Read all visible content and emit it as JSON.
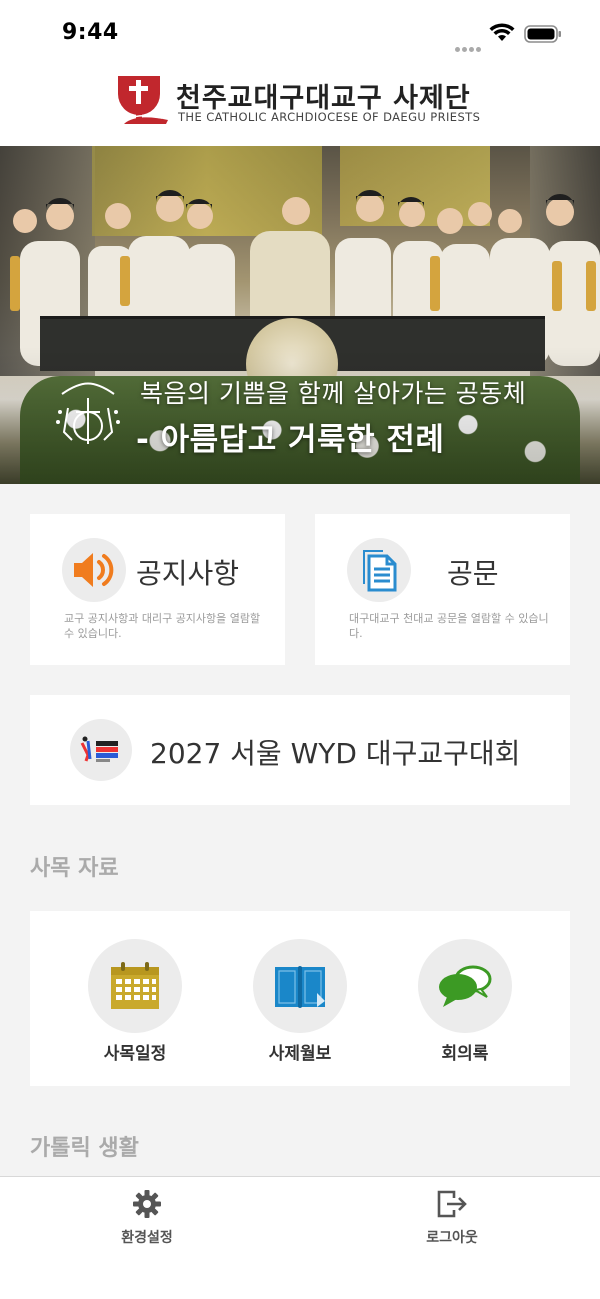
{
  "status_bar": {
    "time": "9:44"
  },
  "header": {
    "title": "천주교대구대교구 사제단",
    "subtitle": "THE CATHOLIC ARCHDIOCESE OF DAEGU PRIESTS"
  },
  "banner": {
    "line1": "복음의 기쁨을 함께 살아가는 공동체",
    "line2": "- 아름답고 거룩한 전례"
  },
  "cards": {
    "notice": {
      "title": "공지사항",
      "description": "교구 공지사항과 대리구 공지사항을 열람할 수 있습니다.",
      "icon": "speaker-icon",
      "accent": "#f07c1e"
    },
    "official": {
      "title": "공문",
      "description": "대구대교구 천대교 공문을 열람할 수 있습니다.",
      "icon": "documents-icon",
      "accent": "#2a8ccf"
    },
    "wyd": {
      "title": "2027 서울 WYD 대구교구대회",
      "icon": "wyd-logo-icon"
    }
  },
  "sections": {
    "pastoral": {
      "title": "사목 자료",
      "items": [
        {
          "label": "사목일정",
          "icon": "calendar-icon",
          "color": "#c9a92c"
        },
        {
          "label": "사제월보",
          "icon": "book-icon",
          "color": "#1a87c9"
        },
        {
          "label": "회의록",
          "icon": "chat-icon",
          "color": "#3c9a24"
        }
      ]
    },
    "catholic_life": {
      "title": "가톨릭 생활"
    }
  },
  "tabbar": {
    "settings": "환경설정",
    "logout": "로그아웃"
  },
  "colors": {
    "brand": "#c1272d",
    "background": "#f3f3f3"
  }
}
